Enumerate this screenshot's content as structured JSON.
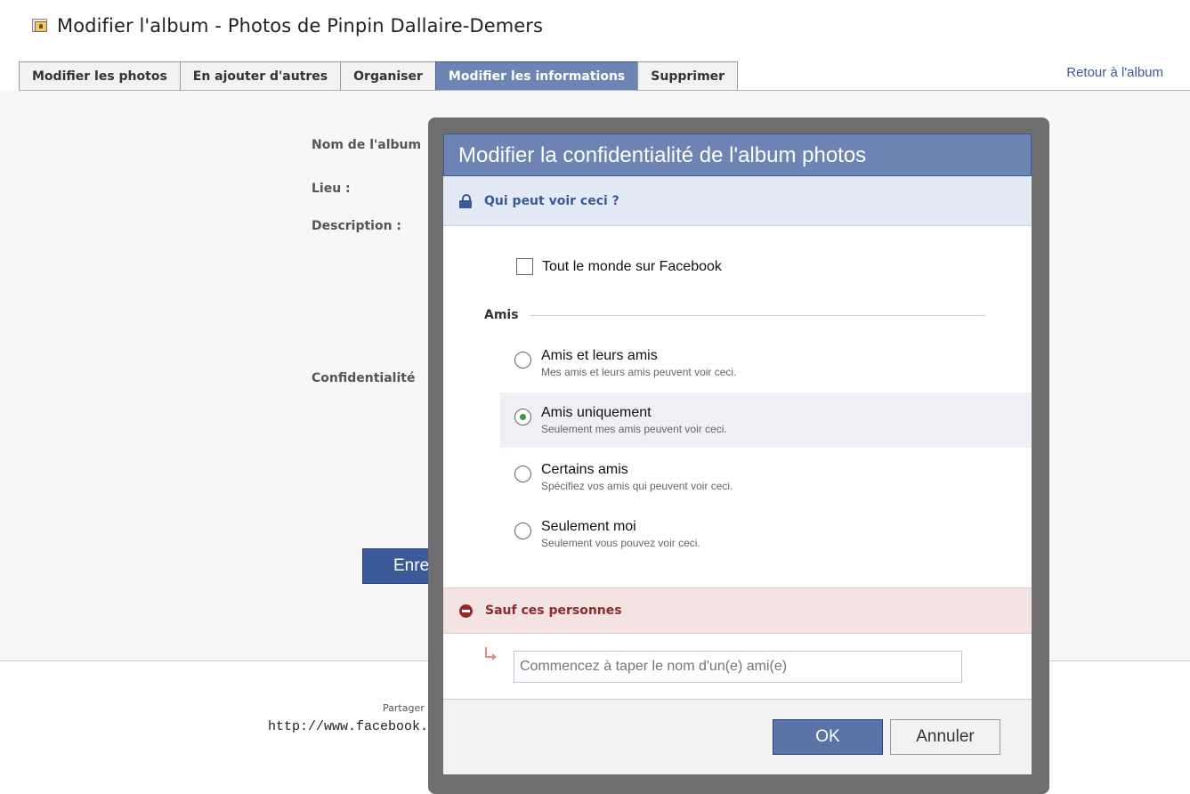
{
  "page": {
    "title": "Modifier l'album - Photos de Pinpin Dallaire-Demers",
    "icon": "photo-album-icon"
  },
  "tabs": [
    {
      "label": "Modifier les photos",
      "active": false
    },
    {
      "label": "En ajouter d'autres",
      "active": false
    },
    {
      "label": "Organiser",
      "active": false
    },
    {
      "label": "Modifier les informations",
      "active": true
    },
    {
      "label": "Supprimer",
      "active": false
    }
  ],
  "back_link": "Retour à l'album",
  "form": {
    "album_name_label": "Nom de l'album",
    "location_label": "Lieu :",
    "description_label": "Description :",
    "privacy_label": "Confidentialité",
    "save_button_partial": "Enre"
  },
  "footer": {
    "share_partial": "Partager",
    "url_partial": "http://www.facebook.c"
  },
  "dialog": {
    "title": "Modifier la confidentialité de l'album photos",
    "who_can_see": "Qui peut voir ceci ?",
    "everyone_option": "Tout le monde sur Facebook",
    "friends_header": "Amis",
    "options": [
      {
        "label": "Amis et leurs amis",
        "desc": "Mes amis et leurs amis peuvent voir ceci.",
        "checked": false
      },
      {
        "label": "Amis uniquement",
        "desc": "Seulement mes amis peuvent voir ceci.",
        "checked": true
      },
      {
        "label": "Certains amis",
        "desc": "Spécifiez vos amis qui peuvent voir ceci.",
        "checked": false
      },
      {
        "label": "Seulement moi",
        "desc": "Seulement vous pouvez voir ceci.",
        "checked": false
      }
    ],
    "except_label": "Sauf ces personnes",
    "except_placeholder": "Commencez à taper le nom d'un(e) ami(e)",
    "ok_label": "OK",
    "cancel_label": "Annuler"
  },
  "colors": {
    "facebook_blue": "#3b5998",
    "tab_active": "#6d84b4",
    "except_red": "#8f2a2a"
  }
}
